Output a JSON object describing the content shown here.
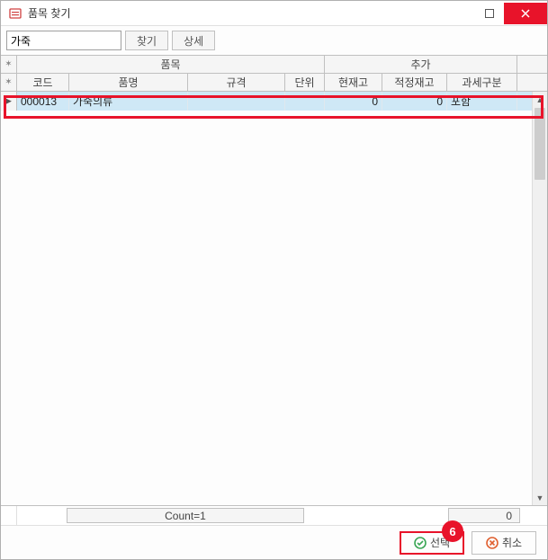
{
  "title": "품목 찾기",
  "search": {
    "value": "가죽",
    "find_label": "찾기",
    "detail_label": "상세"
  },
  "groups": {
    "item": "품목",
    "extra": "추가"
  },
  "columns": {
    "code": "코드",
    "name": "품명",
    "spec": "규격",
    "unit": "단위",
    "stock": "현재고",
    "opt_stock": "적정재고",
    "tax": "과세구분"
  },
  "rows": [
    {
      "code": "000013",
      "name": "가죽의류",
      "spec": "",
      "unit": "",
      "stock": "0",
      "opt_stock": "0",
      "tax": "포함"
    }
  ],
  "status": {
    "count_label": "Count=1",
    "zero": "0"
  },
  "footer": {
    "select_label": "선택",
    "cancel_label": "취소"
  },
  "badge": "6"
}
